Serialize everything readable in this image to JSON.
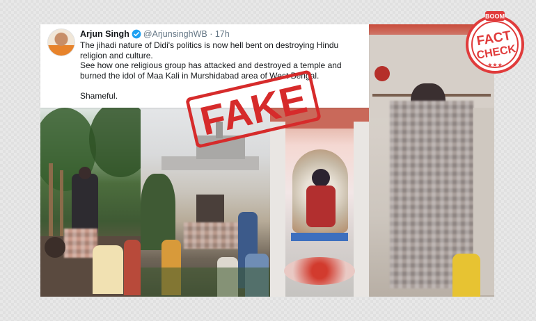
{
  "tweet": {
    "name": "Arjun Singh",
    "handle": "@ArjunsinghWB",
    "separator": "·",
    "time": "17h",
    "line1": "The jihadi nature of Didi's politics is now hell bent on destroying Hindu religion and culture.",
    "line2": "See how one religious group has attacked and destroyed a temple and burned the idol of Maa Kali in Murshidabad area of West Bengal.",
    "line3": "Shameful."
  },
  "stamp": {
    "text": "FAKE",
    "color": "#d62b2b"
  },
  "badge": {
    "top_text": "BOOM",
    "line1": "FACT",
    "line2": "CHECK",
    "stars": "★★★",
    "color": "#e03b3b"
  },
  "icons": [
    "verified-badge-icon"
  ]
}
